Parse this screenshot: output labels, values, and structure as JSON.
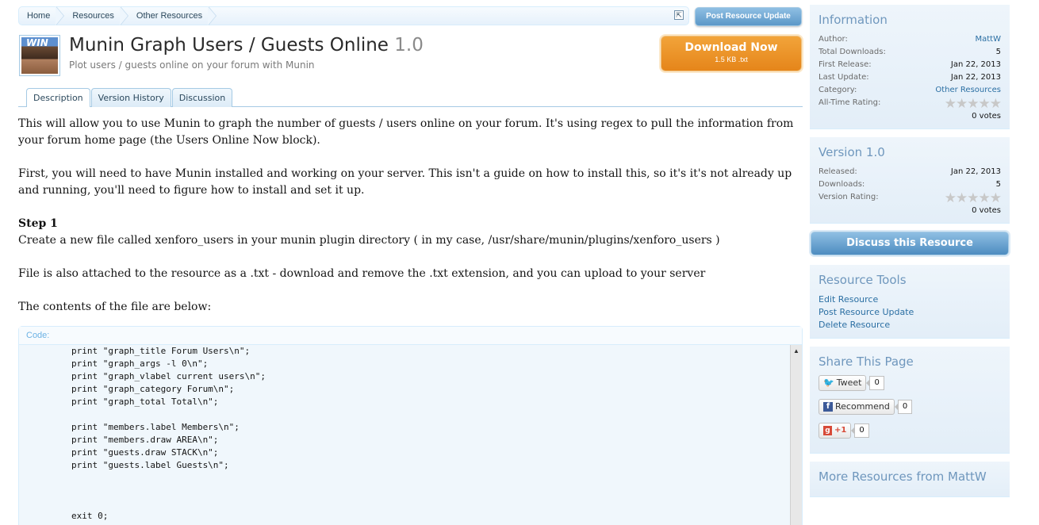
{
  "breadcrumb": [
    "Home",
    "Resources",
    "Other Resources"
  ],
  "post_update_label": "Post Resource Update",
  "resource": {
    "title": "Munin Graph Users / Guests Online",
    "version": "1.0",
    "tagline": "Plot users / guests online on your forum with Munin",
    "avatar_text": "WIN"
  },
  "download": {
    "label": "Download Now",
    "meta": "1.5 KB .txt"
  },
  "tabs": [
    "Description",
    "Version History",
    "Discussion"
  ],
  "description": {
    "p1": "This will allow you to use Munin to graph the number of guests / users online on your forum. It's using regex to pull the information from your forum home page (the Users Online Now block).",
    "p2": "First, you will need to have Munin installed and working on your server. This isn't a guide on how to install this, so it's it's not already up and running, you'll need to figure how to install and set it up.",
    "step_heading": "Step 1",
    "step_text": "Create a new file called xenforo_users in your munin plugin directory ( in my case, /usr/share/munin/plugins/xenforo_users )",
    "p3": "File is also attached to the resource as a .txt - download and remove the .txt extension, and you can upload to your server",
    "p4": "The contents of the file are below:"
  },
  "code": {
    "label": "Code:",
    "text": "print \"graph_title Forum Users\\n\";\nprint \"graph_args -l 0\\n\";\nprint \"graph_vlabel current users\\n\";\nprint \"graph_category Forum\\n\";\nprint \"graph_total Total\\n\";\n\nprint \"members.label Members\\n\";\nprint \"members.draw AREA\\n\";\nprint \"guests.draw STACK\\n\";\nprint \"guests.label Guests\\n\";\n\n\n\nexit 0;"
  },
  "info": {
    "heading": "Information",
    "author_label": "Author:",
    "author": "MattW",
    "downloads_label": "Total Downloads:",
    "downloads": "5",
    "first_release_label": "First Release:",
    "first_release": "Jan 22, 2013",
    "last_update_label": "Last Update:",
    "last_update": "Jan 22, 2013",
    "category_label": "Category:",
    "category": "Other Resources",
    "rating_label": "All-Time Rating:",
    "votes": "0 votes"
  },
  "version_panel": {
    "heading": "Version 1.0",
    "released_label": "Released:",
    "released": "Jan 22, 2013",
    "downloads_label": "Downloads:",
    "downloads": "5",
    "rating_label": "Version Rating:",
    "votes": "0 votes"
  },
  "discuss_label": "Discuss this Resource",
  "tools": {
    "heading": "Resource Tools",
    "links": [
      "Edit Resource",
      "Post Resource Update",
      "Delete Resource"
    ]
  },
  "share": {
    "heading": "Share This Page",
    "tweet": "Tweet",
    "tweet_count": "0",
    "recommend": "Recommend",
    "recommend_count": "0",
    "plusone": "+1",
    "plusone_count": "0"
  },
  "more_heading": "More Resources from MattW"
}
